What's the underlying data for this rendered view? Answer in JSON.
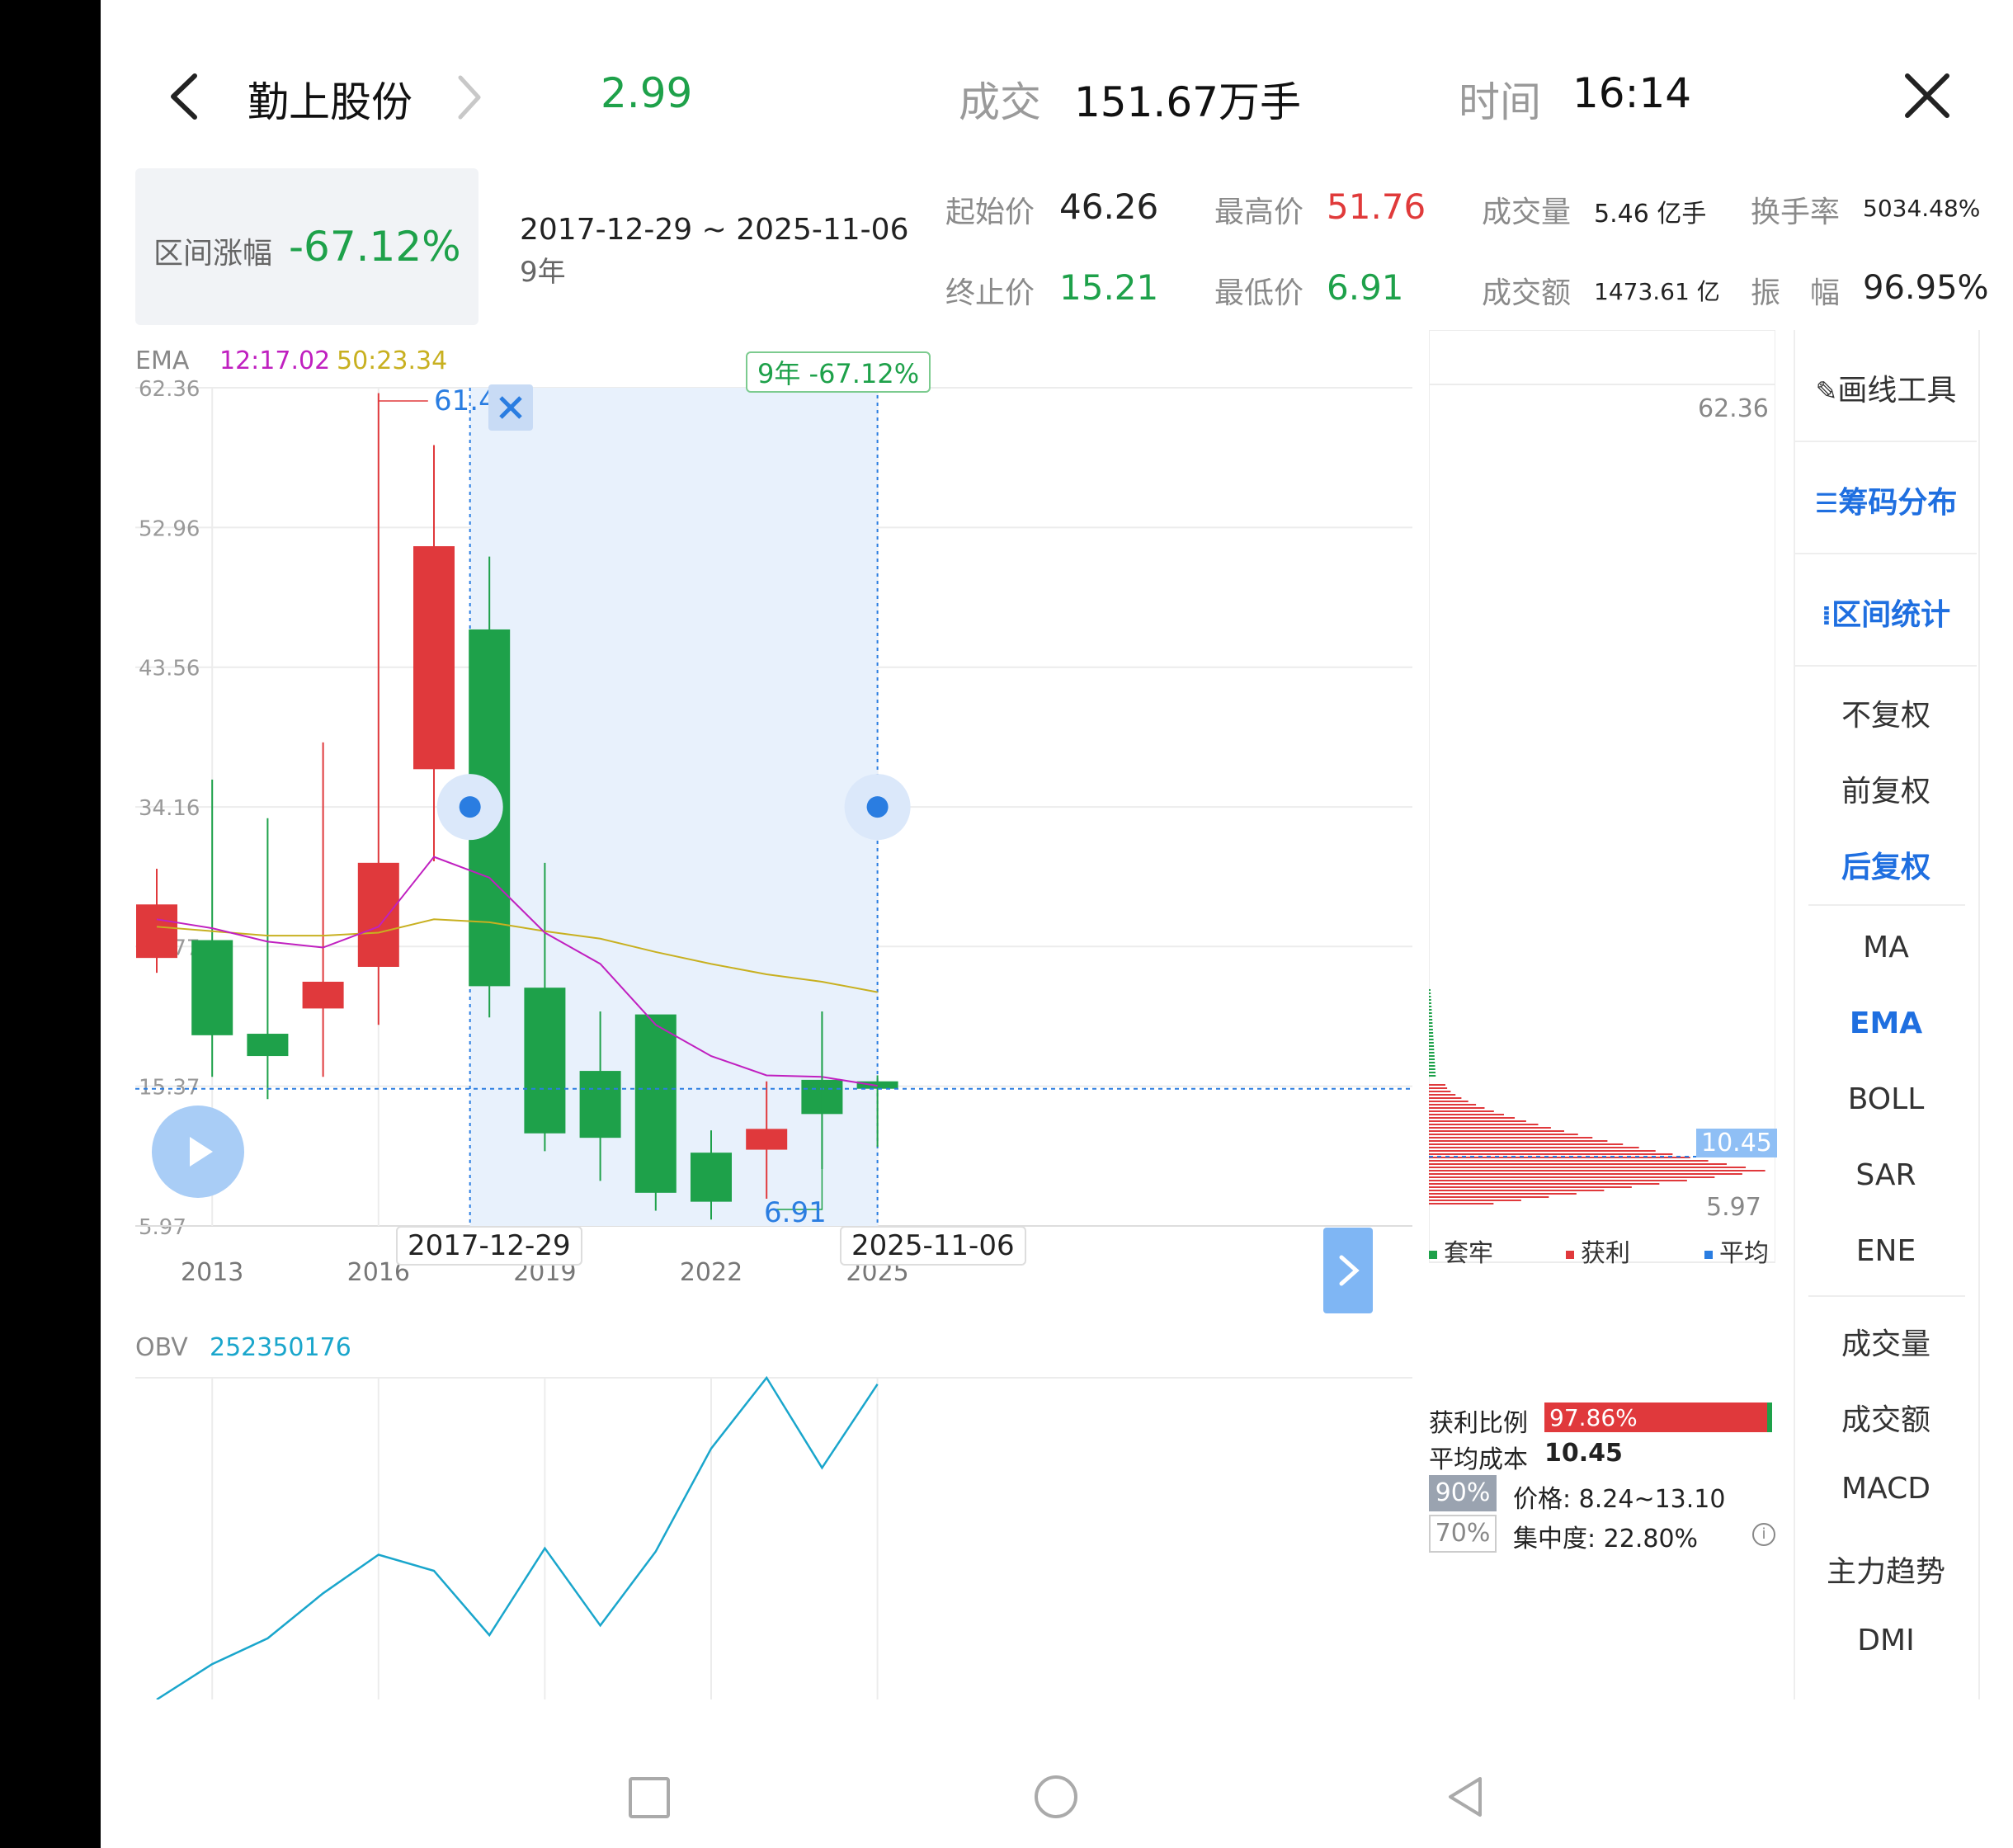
{
  "header": {
    "stock_name": "勤上股份",
    "price": "2.99",
    "volume_label": "成交",
    "volume_value": "151.67万手",
    "time_label": "时间",
    "time_value": "16:14"
  },
  "range_stats": {
    "change_label": "区间涨幅",
    "change_value": "-67.12%",
    "date_range": "2017-12-29 ~ 2025-11-06",
    "duration": "9年",
    "start_label": "起始价",
    "start_value": "46.26",
    "end_label": "终止价",
    "end_value": "15.21",
    "high_label": "最高价",
    "high_value": "51.76",
    "low_label": "最低价",
    "low_value": "6.91",
    "vol_label": "成交量",
    "vol_value": "5.46 亿手",
    "amount_label": "成交额",
    "amount_value": "1473.61 亿",
    "turnover_label": "换手率",
    "turnover_value": "5034.48%",
    "amp_label": "振　幅",
    "amp_value": "96.95%"
  },
  "main_chart": {
    "indicator": "EMA",
    "ema_fast": "12:17.02",
    "ema_slow": "50:23.34",
    "range_tag": "9年 -67.12%",
    "high_marker": "61.42",
    "low_marker": "6.91",
    "range_start_label": "2017-12-29",
    "range_end_label": "2025-11-06",
    "y_ticks": [
      "62.36",
      "52.96",
      "43.56",
      "34.16",
      "24.77",
      "15.37",
      "5.97"
    ],
    "x_ticks": [
      "2013",
      "2016",
      "2019",
      "2022",
      "2025"
    ]
  },
  "chart_data": {
    "type": "candlestick",
    "x": [
      "2012",
      "2013",
      "2014",
      "2015",
      "2016",
      "2017",
      "2018",
      "2019",
      "2020",
      "2021",
      "2022",
      "2023",
      "2024",
      "2025"
    ],
    "open": [
      24.0,
      25.2,
      18.9,
      20.6,
      23.4,
      36.7,
      46.1,
      22.0,
      16.4,
      20.2,
      10.9,
      11.1,
      15.8,
      15.7
    ],
    "close": [
      27.6,
      18.8,
      17.4,
      22.4,
      30.4,
      51.7,
      22.1,
      12.2,
      11.9,
      8.2,
      7.6,
      12.5,
      13.5,
      15.2
    ],
    "high": [
      30.0,
      36.0,
      33.4,
      38.5,
      62.0,
      58.5,
      51.0,
      30.4,
      20.4,
      20.0,
      12.4,
      15.7,
      20.4,
      16.1
    ],
    "low": [
      23.0,
      16.0,
      14.5,
      16.0,
      19.5,
      30.5,
      20.0,
      11.0,
      9.0,
      7.0,
      6.4,
      7.8,
      9.8,
      11.3
    ],
    "ema12": [
      26.6,
      26.0,
      25.1,
      24.7,
      26.1,
      30.8,
      29.4,
      25.7,
      23.6,
      19.5,
      17.4,
      16.1,
      16.0,
      15.4
    ],
    "ema50": [
      26.1,
      25.8,
      25.5,
      25.5,
      25.7,
      26.6,
      26.4,
      25.8,
      25.3,
      24.4,
      23.6,
      22.9,
      22.4,
      21.7
    ],
    "ylim": [
      5.97,
      62.36
    ]
  },
  "obv": {
    "label": "OBV",
    "value": "252350176",
    "series": [
      0.0,
      0.11,
      0.19,
      0.33,
      0.45,
      0.4,
      0.2,
      0.47,
      0.23,
      0.46,
      0.78,
      1.0,
      0.72,
      0.98
    ]
  },
  "chip_distribution": {
    "top_price": "62.36",
    "bottom_price": "5.97",
    "avg_cost_tag": "10.45",
    "legend": [
      "套牢",
      "获利",
      "平均"
    ],
    "profit_label": "获利比例",
    "profit_value": "97.86%",
    "profit_ratio": 0.9786,
    "avg_cost_label": "平均成本",
    "avg_cost_value": "10.45",
    "pct90": "90%",
    "price_range": "价格: 8.24~13.10",
    "pct70": "70%",
    "concentration": "集中度: 22.80%"
  },
  "side_menu": {
    "tools": [
      "画线工具",
      "筹码分布",
      "区间统计"
    ],
    "adjust": [
      "不复权",
      "前复权",
      "后复权"
    ],
    "indicators": [
      "MA",
      "EMA",
      "BOLL",
      "SAR",
      "ENE"
    ],
    "sub_indicators": [
      "成交量",
      "成交额",
      "MACD",
      "主力趋势",
      "DMI"
    ]
  },
  "colors": {
    "up": "#e0393c",
    "down": "#1ea14a",
    "accent": "#2a7de1",
    "ema12": "#c020c0",
    "ema50": "#c8b020",
    "obv": "#1aa6cc"
  }
}
